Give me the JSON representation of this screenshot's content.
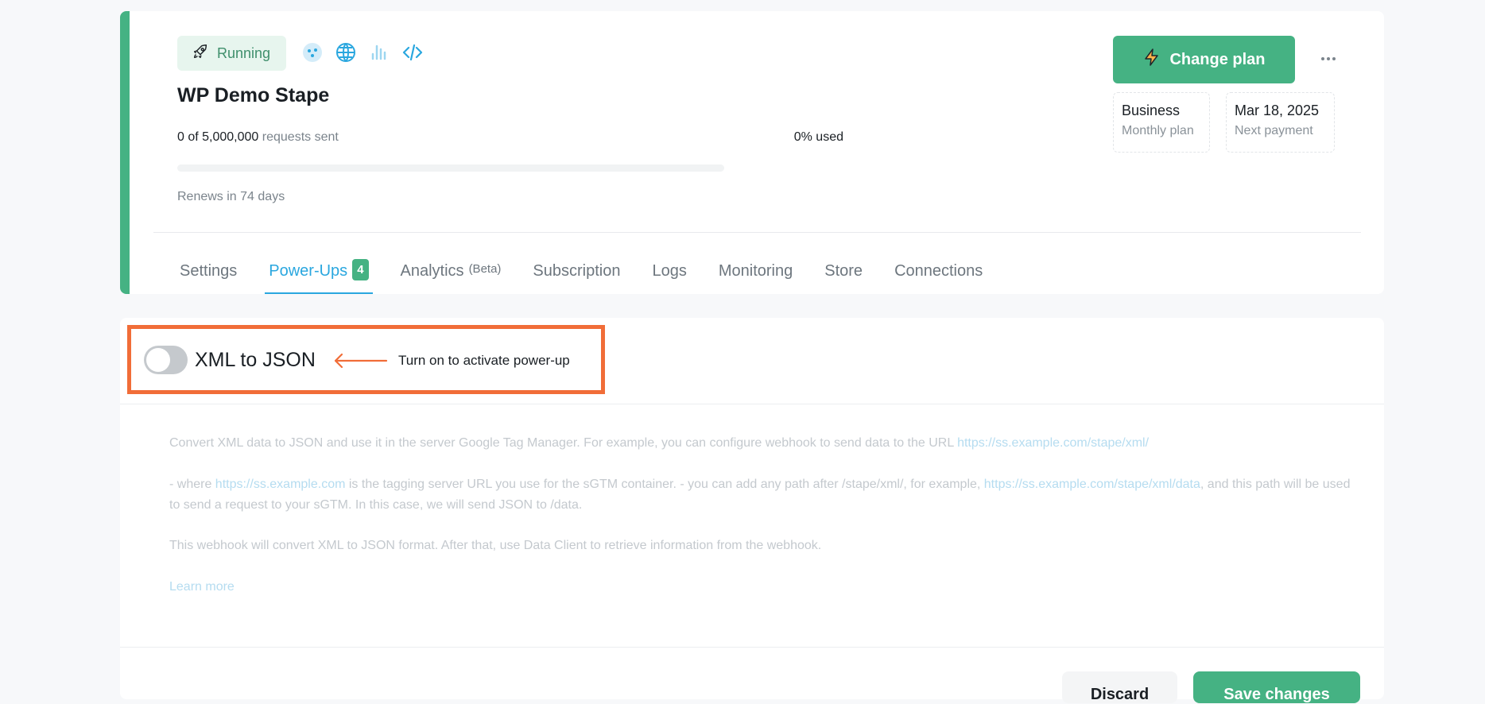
{
  "container": {
    "status": "Running",
    "name": "WP Demo Stape",
    "usage": {
      "sent": "0 of 5,000,000",
      "suffix": "requests sent",
      "percent_label": "0% used",
      "percent": 0
    },
    "renews": "Renews in 74 days",
    "feature_icons": [
      "cluster-icon",
      "globe-icon",
      "signal-icon",
      "code-icon"
    ]
  },
  "plan": {
    "change_plan_label": "Change plan",
    "plan_name": "Business",
    "plan_period": "Monthly plan",
    "next_payment_date": "Mar 18, 2025",
    "next_payment_label": "Next payment"
  },
  "tabs": [
    {
      "label": "Settings"
    },
    {
      "label": "Power-Ups",
      "count": "4",
      "active": true
    },
    {
      "label": "Analytics",
      "badge": "(Beta)"
    },
    {
      "label": "Subscription"
    },
    {
      "label": "Logs"
    },
    {
      "label": "Monitoring"
    },
    {
      "label": "Store"
    },
    {
      "label": "Connections"
    }
  ],
  "powerup": {
    "title": "XML to JSON",
    "enabled": false,
    "hint": "Turn on to activate power-up",
    "desc1_text": "Convert XML data to JSON and use it in the server Google Tag Manager. For example, you can configure webhook to send data to the URL ",
    "desc1_link": "https://ss.example.com/stape/xml/",
    "desc2_a": "- where ",
    "desc2_link1": "https://ss.example.com",
    "desc2_b": " is the tagging server URL you use for the sGTM container. - you can add any path after /stape/xml/, for example, ",
    "desc2_link2": "https://ss.example.com/stape/xml/data",
    "desc2_c": ", and this path will be used to send a request to your sGTM. In this case, we will send JSON to /data.",
    "desc3": "This webhook will convert XML to JSON format. After that, use Data Client to retrieve information from the webhook.",
    "learn_more": "Learn more"
  },
  "footer": {
    "discard_label": "Discard",
    "save_label": "Save changes"
  },
  "colors": {
    "accent": "#45b283",
    "link": "#2aa7df",
    "highlight": "#f16d38"
  }
}
